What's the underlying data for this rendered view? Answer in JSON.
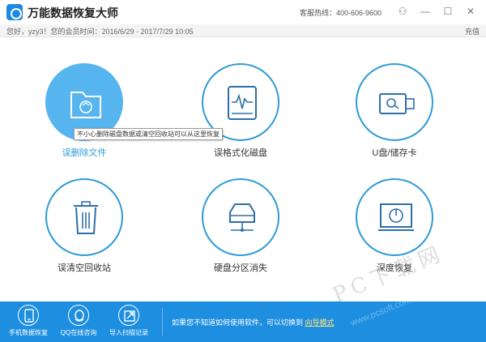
{
  "window": {
    "title": "万能数据恢复大师",
    "hotline": "客服热线：400-606-9600"
  },
  "account": {
    "info": "您好，yzy3！您的会员时间：2016/6/29 - 2017/7/29 10:05",
    "recharge_label": "充值"
  },
  "modes": [
    {
      "label": "误删除文件",
      "icon": "folder-recycle-icon",
      "active": true
    },
    {
      "label": "误格式化磁盘",
      "icon": "disk-icon"
    },
    {
      "label": "U盘/储存卡",
      "icon": "usb-drive-icon"
    },
    {
      "label": "误清空回收站",
      "icon": "recycle-bin-icon"
    },
    {
      "label": "硬盘分区消失",
      "icon": "network-disk-icon"
    },
    {
      "label": "深度恢复",
      "icon": "monitor-icon"
    }
  ],
  "tooltip": "不小心删除磁盘数据或清空回收站可以从这里恢复",
  "bottom": {
    "items": [
      {
        "label": "手机数据恢复",
        "icon": "phone-icon"
      },
      {
        "label": "QQ在线咨询",
        "icon": "qq-icon"
      },
      {
        "label": "导入扫描记录",
        "icon": "import-icon"
      }
    ],
    "guide_text": "如果您不知道如何使用软件，可以切换到",
    "guide_link": "向导模式"
  },
  "watermark": {
    "brand": "PC下载网",
    "url": "www.pcsoft.com.cn"
  },
  "colors": {
    "accent": "#2f9bd8",
    "active_fill": "#56b4ee",
    "bottom_bar": "#1e8fe0"
  }
}
